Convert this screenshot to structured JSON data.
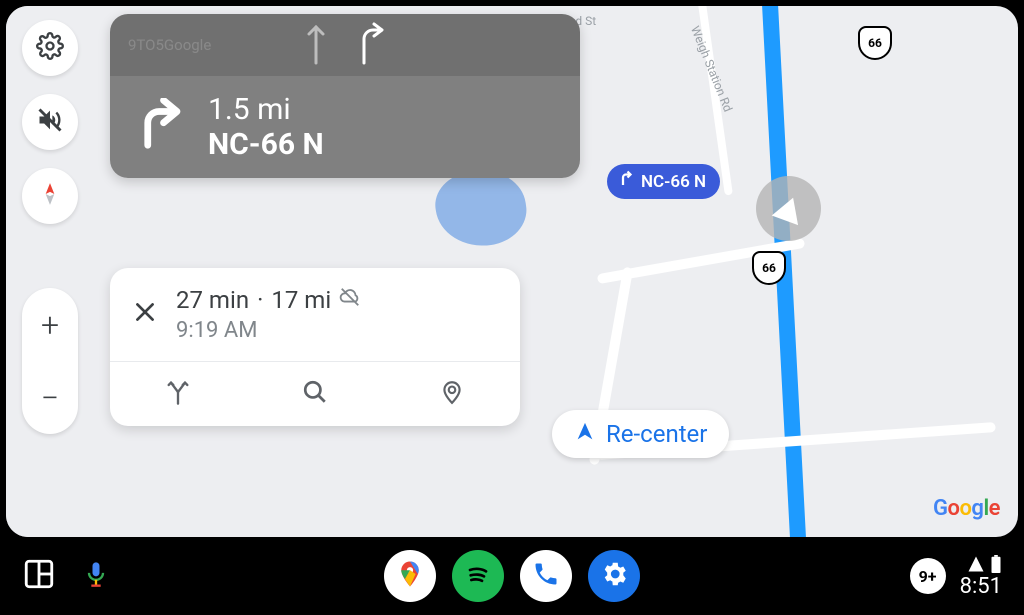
{
  "map": {
    "route_shield": "66",
    "turn_pill_label": "NC-66 N",
    "road_label_1": "oad St",
    "road_label_2": "Weigh Station Rd"
  },
  "direction": {
    "watermark": "9TO5Google",
    "distance": "1.5 mi",
    "road": "NC-66 N"
  },
  "eta": {
    "time_remaining": "27 min",
    "distance_remaining": "17 mi",
    "arrival_time": "9:19 AM",
    "separator": "·"
  },
  "recenter": {
    "label": "Re-center"
  },
  "sidebar": {
    "zoom_in": "+",
    "zoom_out": "−"
  },
  "bottombar": {
    "notification_count": "9+",
    "clock": "8:51"
  },
  "google_logo": {
    "c1": "G",
    "c2": "o",
    "c3": "o",
    "c4": "g",
    "c5": "l",
    "c6": "e"
  }
}
